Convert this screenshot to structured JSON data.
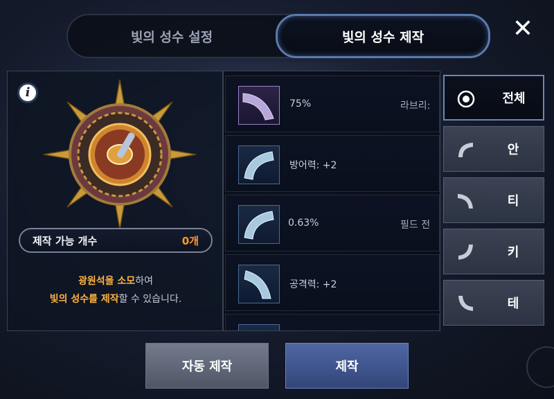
{
  "tabs": {
    "setting_label": "빛의 성수 설정",
    "make_label": "빛의 성수 제작"
  },
  "close_label": "✕",
  "left": {
    "info_glyph": "i",
    "count_label": "제작 가능 개수",
    "count_value": "0개",
    "desc_line1_hl": "광원석을 소모",
    "desc_line1_rest": "하여",
    "desc_line2_hl": "빛의 성수를 제작",
    "desc_line2_rest": "할 수 있습니다."
  },
  "items": [
    {
      "stat": "75%",
      "name": "라브리:"
    },
    {
      "stat": "방어력: +2",
      "name": ""
    },
    {
      "stat": "0.63%",
      "name": "필드 전"
    },
    {
      "stat": "공격력: +2",
      "name": ""
    },
    {
      "stat": "",
      "name": ""
    }
  ],
  "filters": [
    {
      "label": "전체",
      "icon": "target-icon"
    },
    {
      "label": "안",
      "icon": "arc-segment-icon"
    },
    {
      "label": "티",
      "icon": "arc-segment-icon"
    },
    {
      "label": "키",
      "icon": "arc-segment-icon"
    },
    {
      "label": "테",
      "icon": "arc-segment-icon"
    }
  ],
  "buttons": {
    "auto_label": "자동 제작",
    "make_label": "제작"
  },
  "colors": {
    "highlight": "#ffb340",
    "count": "#ff9a2e",
    "accent_border": "#5a7ab0"
  }
}
